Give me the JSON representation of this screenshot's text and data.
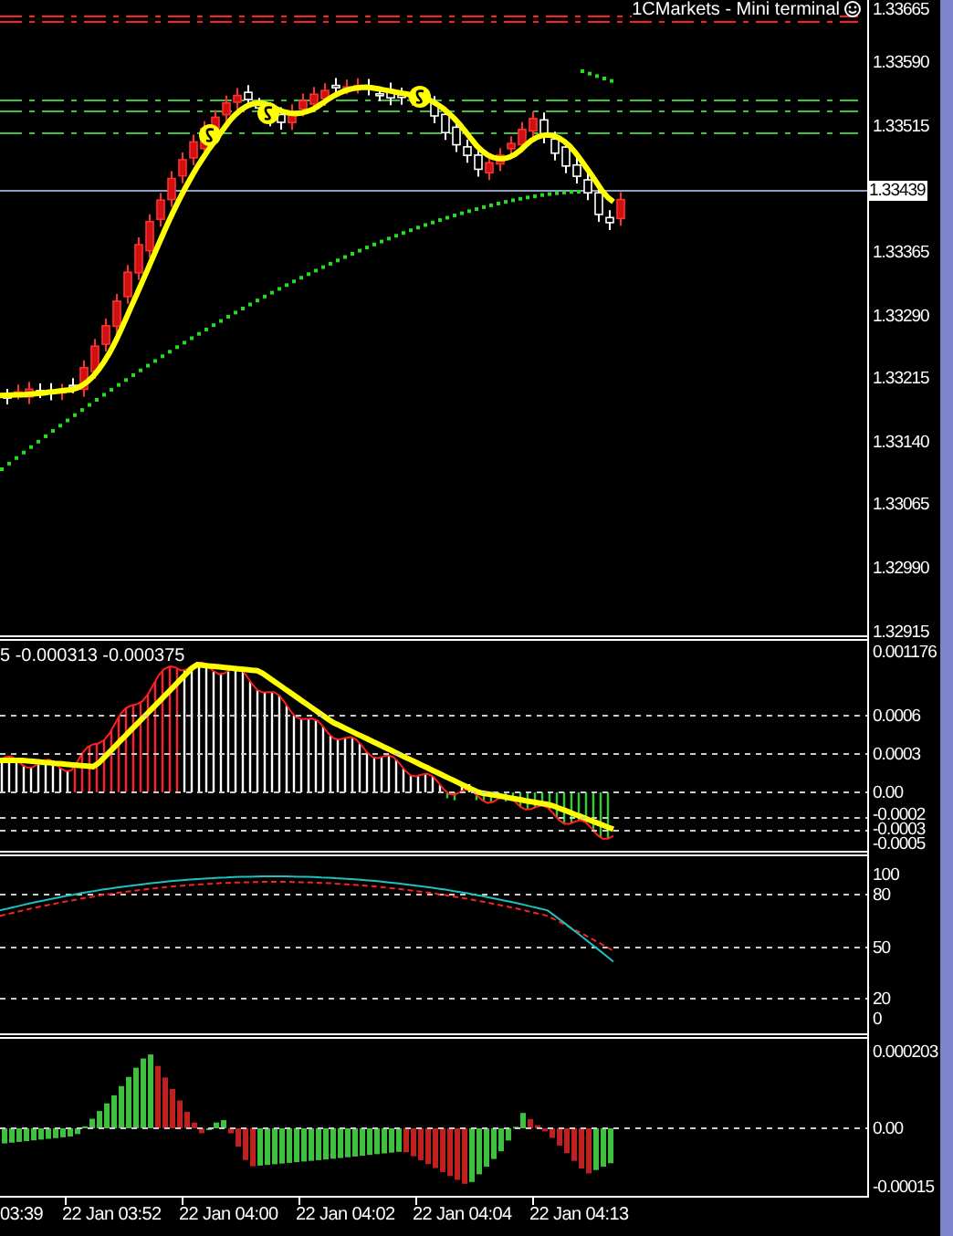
{
  "window": {
    "title": "1CMarkets - Mini terminal"
  },
  "price_axis": {
    "labels": [
      "1.33665",
      "1.33590",
      "1.33515",
      "1.33365",
      "1.33290",
      "1.33215",
      "1.33140",
      "1.33065",
      "1.32990",
      "1.32915"
    ],
    "current_price": "1.33439"
  },
  "macd_panel": {
    "legend": "5 -0.000313 -0.000375",
    "axis_labels": [
      "0.001176",
      "0.0006",
      "0.0003",
      "0.00",
      "-0.0002",
      "-0.0003",
      "-0.0005"
    ]
  },
  "stochastic_panel": {
    "axis_labels": [
      "100",
      "80",
      "50",
      "20",
      "0"
    ]
  },
  "oscillator_panel": {
    "axis_labels": [
      "0.000203",
      "0.00",
      "-0.00015"
    ]
  },
  "time_axis": {
    "labels": [
      "03:39",
      "22 Jan 03:52",
      "22 Jan 04:00",
      "22 Jan 04:02",
      "22 Jan 04:04",
      "22 Jan 04:13"
    ]
  }
}
